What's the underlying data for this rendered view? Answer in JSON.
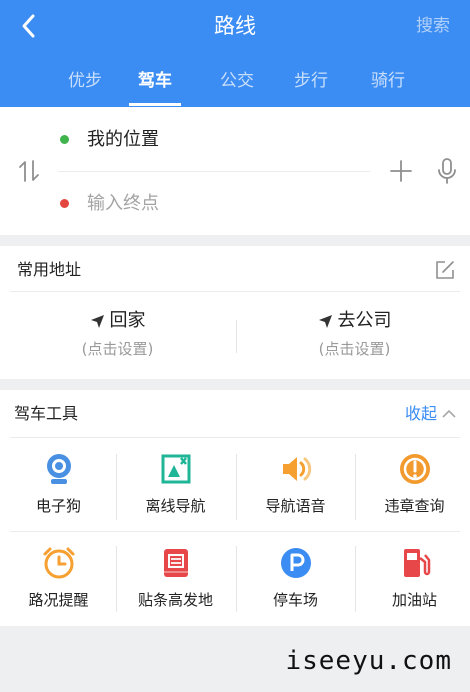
{
  "header": {
    "title": "路线",
    "search_label": "搜索",
    "tabs": [
      {
        "label": "优步"
      },
      {
        "label": "驾车"
      },
      {
        "label": "公交"
      },
      {
        "label": "步行"
      },
      {
        "label": "骑行"
      }
    ],
    "active_tab": "驾车"
  },
  "route": {
    "from": "我的位置",
    "to_placeholder": "输入终点"
  },
  "addresses": {
    "title": "常用地址",
    "items": [
      {
        "name": "回家",
        "hint": "(点击设置)"
      },
      {
        "name": "去公司",
        "hint": "(点击设置)"
      }
    ]
  },
  "tools": {
    "title": "驾车工具",
    "collapse_label": "收起",
    "items": [
      {
        "label": "电子狗",
        "icon": "camera-icon"
      },
      {
        "label": "离线导航",
        "icon": "offline-map-icon"
      },
      {
        "label": "导航语音",
        "icon": "speaker-icon"
      },
      {
        "label": "违章查询",
        "icon": "violation-icon"
      },
      {
        "label": "路况提醒",
        "icon": "alarm-clock-icon"
      },
      {
        "label": "贴条高发地",
        "icon": "ticket-icon"
      },
      {
        "label": "停车场",
        "icon": "parking-icon"
      },
      {
        "label": "加油站",
        "icon": "gas-station-icon"
      }
    ]
  },
  "watermark": "iseeyu.com",
  "colors": {
    "primary": "#3b8cf3",
    "start_dot": "#3fb44c",
    "end_dot": "#e2463e"
  }
}
